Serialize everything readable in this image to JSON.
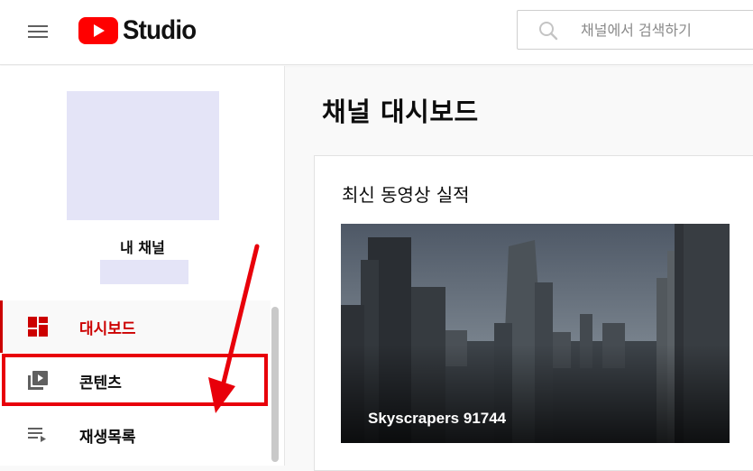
{
  "header": {
    "logo_text": "Studio",
    "search_placeholder": "채널에서 검색하기"
  },
  "sidebar": {
    "channel_label": "내 채널",
    "items": [
      {
        "label": "대시보드",
        "icon": "dashboard-icon",
        "active": true
      },
      {
        "label": "콘텐츠",
        "icon": "content-icon",
        "active": false
      },
      {
        "label": "재생목록",
        "icon": "playlist-icon",
        "active": false
      }
    ]
  },
  "main": {
    "title": "채널 대시보드",
    "card": {
      "title": "최신 동영상 실적",
      "video_title": "Skyscrapers 91744"
    }
  },
  "colors": {
    "brand_red": "#ff0000",
    "active_red": "#cc0000",
    "annotation_red": "#e8000a"
  }
}
